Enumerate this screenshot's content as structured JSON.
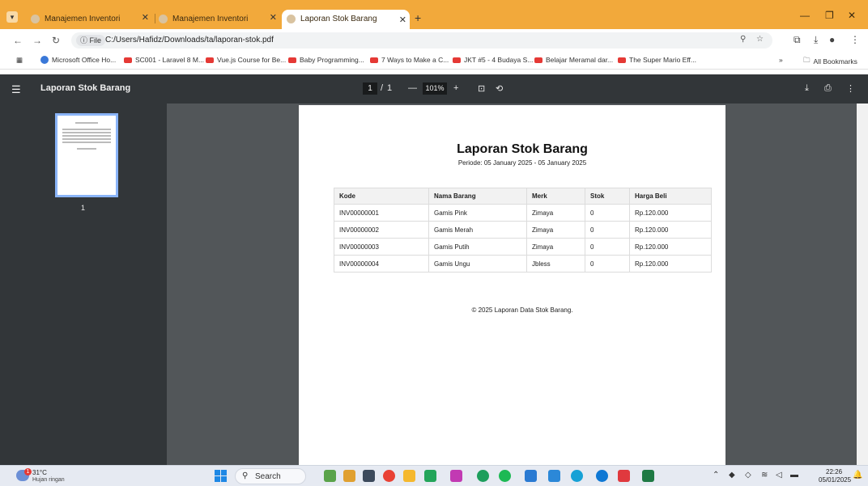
{
  "browser": {
    "tabs": [
      {
        "label": "Manajemen Inventori"
      },
      {
        "label": "Manajemen Inventori"
      },
      {
        "label": "Laporan Stok Barang"
      }
    ],
    "address": {
      "chip": "File",
      "url": "C:/Users/Hafidz/Downloads/ta/laporan-stok.pdf"
    },
    "bookmarks": [
      {
        "label": "Microsoft Office Ho..."
      },
      {
        "label": "SC001 - Laravel 8 M..."
      },
      {
        "label": "Vue.js Course for Be..."
      },
      {
        "label": "Baby Programming..."
      },
      {
        "label": "7 Ways to Make a C..."
      },
      {
        "label": "JKT #5 - 4 Budaya S..."
      },
      {
        "label": "Belajar Meramal dar..."
      },
      {
        "label": "The Super Mario Eff..."
      }
    ],
    "all_bookmarks": "All Bookmarks",
    "overflow": "»"
  },
  "pdf_toolbar": {
    "title": "Laporan Stok Barang",
    "page_current": "1",
    "page_sep": "/",
    "page_total": "1",
    "zoom_minus": "—",
    "zoom": "101%",
    "zoom_plus": "+"
  },
  "thumbnail": {
    "page_label": "1"
  },
  "document": {
    "title": "Laporan Stok Barang",
    "period": "Periode: 05 January 2025 - 05 January 2025",
    "columns": [
      "Kode",
      "Nama Barang",
      "Merk",
      "Stok",
      "Harga Beli"
    ],
    "rows": [
      [
        "INV00000001",
        "Gamis Pink",
        "Zimaya",
        "0",
        "Rp.120.000"
      ],
      [
        "INV00000002",
        "Gamis Merah",
        "Zimaya",
        "0",
        "Rp.120.000"
      ],
      [
        "INV00000003",
        "Gamis Putih",
        "Zimaya",
        "0",
        "Rp.120.000"
      ],
      [
        "INV00000004",
        "Gamis Ungu",
        "Jbless",
        "0",
        "Rp.120.000"
      ]
    ],
    "footer": "© 2025 Laporan Data Stok Barang."
  },
  "taskbar": {
    "weather_badge": "1",
    "temperature": "31°C",
    "weather": "Hujan ringan",
    "search": "Search",
    "time": "22:26",
    "date": "05/01/2025"
  },
  "colors": {
    "tabstrip": "#f2a93b",
    "pdf_toolbar": "#323639",
    "viewer_bg": "#525659",
    "thumb_border": "#8ab4f8"
  }
}
